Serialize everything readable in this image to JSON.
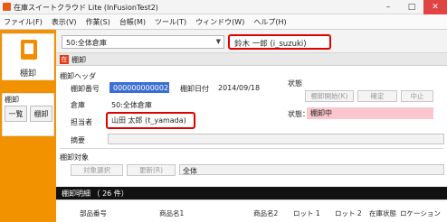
{
  "window": {
    "title": "在庫スイートクラウド Lite (InFusionTest2)"
  },
  "menu": [
    "ファイル(F)",
    "表示(V)",
    "作業(S)",
    "台帳(M)",
    "ツール(T)",
    "ウィンドウ(W)",
    "ヘルプ(H)"
  ],
  "sidebar": {
    "main_label": "棚卸",
    "group_label": "棚卸",
    "btn_list": "一覧",
    "btn_inventory": "棚卸"
  },
  "topbar": {
    "warehouse_select": "50:全体倉庫",
    "user": "鈴木 一郎 (i_suzuki)"
  },
  "panel": {
    "badge": "在",
    "title": "棚卸",
    "header_section": "棚卸ヘッダ",
    "number_label": "棚卸番号",
    "number_value": "000000000002",
    "date_label": "棚卸日付",
    "date_value": "2014/09/18",
    "warehouse_label": "倉庫",
    "warehouse_value": "50:全体倉庫",
    "person_label": "担当者",
    "person_value": "山田 太郎 (t_yamada)",
    "memo_label": "摘要",
    "status_section": "状態",
    "btn_start": "棚卸開始(K)",
    "btn_confirm": "確定",
    "btn_stop": "中止",
    "status_label": "状態：",
    "status_value": "棚卸中",
    "target_section": "棚卸対象",
    "btn_select": "対象選択",
    "btn_update": "更新(R)",
    "target_value": "全体"
  },
  "details": {
    "title": "棚卸明細 （ 26 件）",
    "columns": [
      "部品番号",
      "商品名1",
      "商品名2",
      "ロット 1",
      "ロット 2",
      "在庫状態",
      "ロケーション"
    ]
  },
  "colors": {
    "accent": "#f39200",
    "highlight": "#e00000",
    "status_bg": "#fbc5cd"
  }
}
